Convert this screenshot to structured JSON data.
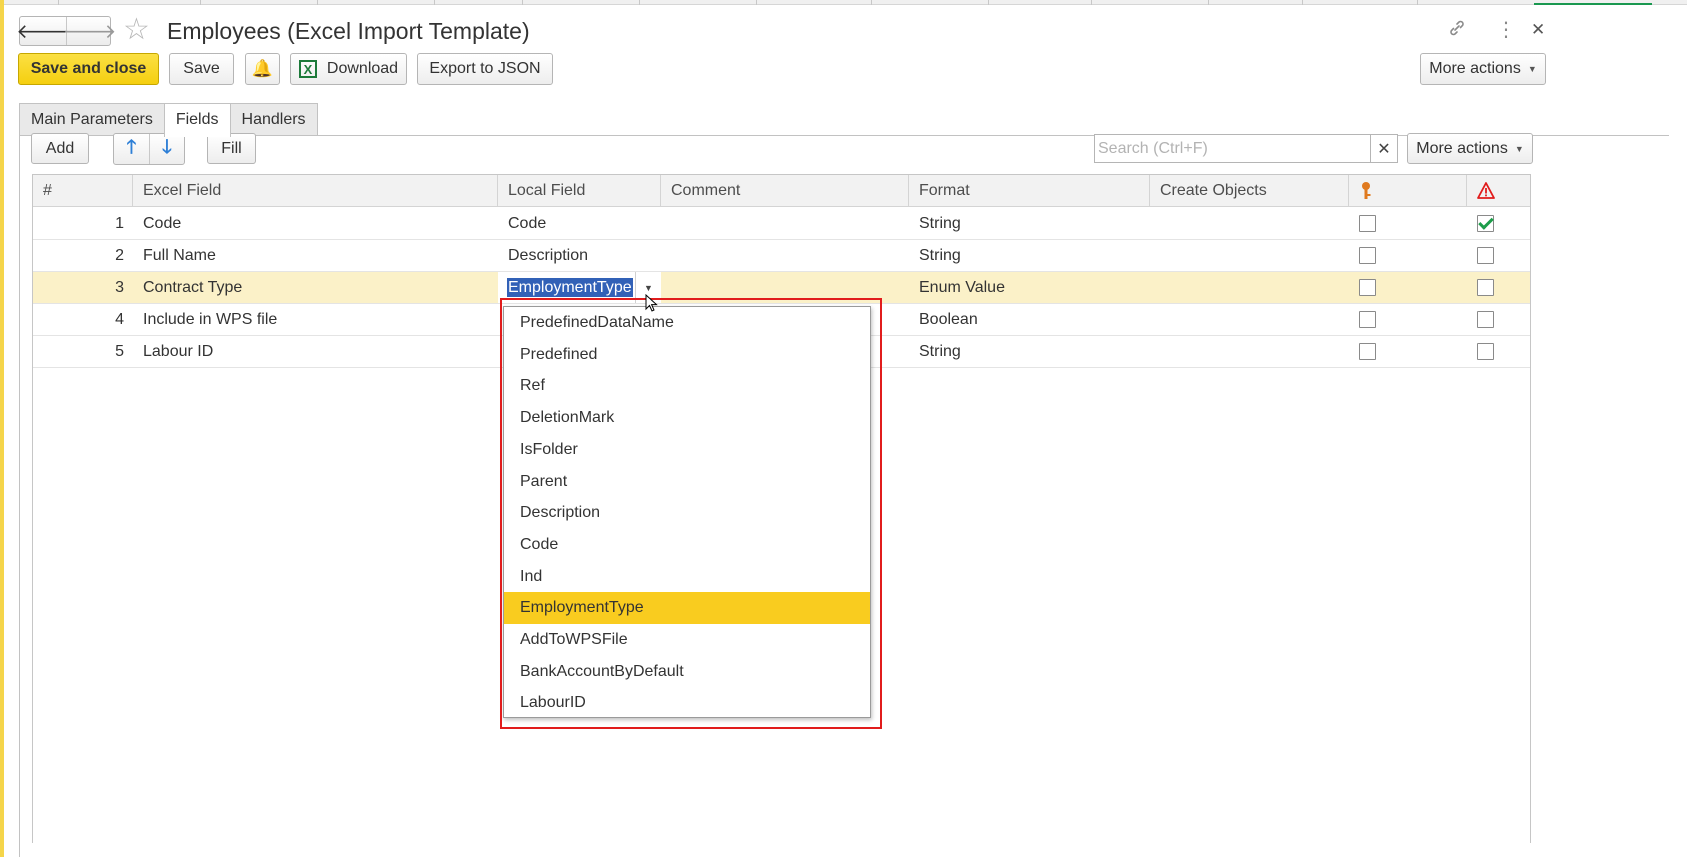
{
  "window": {
    "title": "Employees (Excel Import Template)",
    "back_icon": "arrow-left-icon",
    "forward_icon": "arrow-right-icon",
    "favorite_icon": "star-icon",
    "link_icon": "link-icon",
    "menu_icon": "kebab-icon",
    "close_icon": "close-icon"
  },
  "toolbar": {
    "save_close_label": "Save and close",
    "save_label": "Save",
    "download_label": "Download",
    "export_label": "Export to JSON",
    "more_actions_label": "More actions"
  },
  "tabs": [
    {
      "label": "Main Parameters",
      "active": false
    },
    {
      "label": "Fields",
      "active": true
    },
    {
      "label": "Handlers",
      "active": false
    }
  ],
  "fields_toolbar": {
    "add_label": "Add",
    "fill_label": "Fill",
    "search_placeholder": "Search (Ctrl+F)",
    "more_actions_label": "More actions"
  },
  "table": {
    "columns": [
      "#",
      "Excel Field",
      "Local Field",
      "Comment",
      "Format",
      "Create Objects"
    ],
    "key_column_icon": "key-icon",
    "warning_column_icon": "warning-icon",
    "rows": [
      {
        "num": "1",
        "excel_field": "Code",
        "local_field": "Code",
        "comment": "",
        "format": "String",
        "create_objects": "",
        "key": false,
        "required": true
      },
      {
        "num": "2",
        "excel_field": "Full Name",
        "local_field": "Description",
        "comment": "",
        "format": "String",
        "create_objects": "",
        "key": false,
        "required": false
      },
      {
        "num": "3",
        "excel_field": "Contract Type",
        "local_field": "EmploymentType",
        "comment": "",
        "format": "Enum Value",
        "create_objects": "",
        "key": false,
        "required": false,
        "selected": true,
        "editing": true
      },
      {
        "num": "4",
        "excel_field": "Include in WPS file",
        "local_field": "",
        "comment": "",
        "format": "Boolean",
        "create_objects": "",
        "key": false,
        "required": false
      },
      {
        "num": "5",
        "excel_field": "Labour ID",
        "local_field": "",
        "comment": "",
        "format": "String",
        "create_objects": "",
        "key": false,
        "required": false
      }
    ]
  },
  "dropdown": {
    "items": [
      "PredefinedDataName",
      "Predefined",
      "Ref",
      "DeletionMark",
      "IsFolder",
      "Parent",
      "Description",
      "Code",
      "Ind",
      "EmploymentType",
      "AddToWPSFile",
      "BankAccountByDefault",
      "LabourID"
    ],
    "active": "EmploymentType"
  },
  "colors": {
    "primary_button": "#f5cf10",
    "selected_row": "#fbf1c8",
    "dropdown_active": "#f9cc1f",
    "highlight_border": "#e11c1c",
    "text_selection": "#3261b7"
  }
}
